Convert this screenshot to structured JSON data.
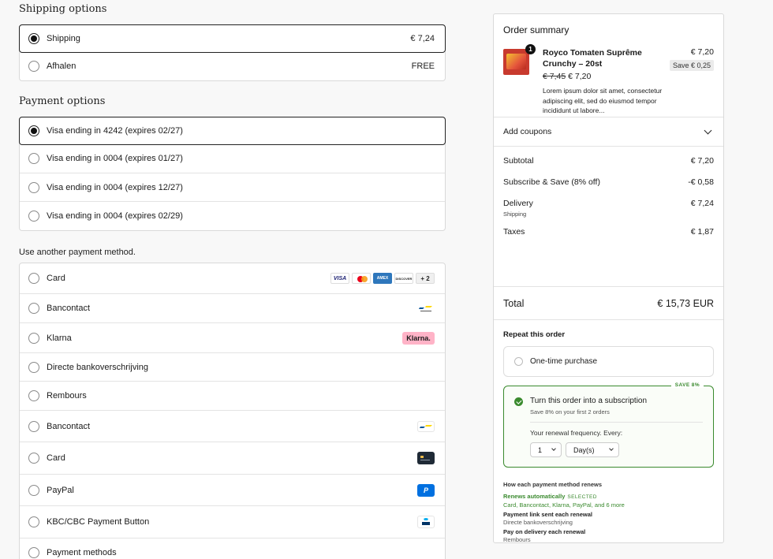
{
  "shipping": {
    "title": "Shipping options",
    "options": [
      {
        "label": "Shipping",
        "price": "€ 7,24",
        "selected": true
      },
      {
        "label": "Afhalen",
        "price": "FREE",
        "selected": false
      }
    ]
  },
  "payment": {
    "title": "Payment options",
    "cards": [
      {
        "label": "Visa ending in 4242 (expires 02/27)",
        "selected": true
      },
      {
        "label": "Visa ending in 0004 (expires 01/27)",
        "selected": false
      },
      {
        "label": "Visa ending in 0004 (expires 12/27)",
        "selected": false
      },
      {
        "label": "Visa ending in 0004 (expires 02/29)",
        "selected": false
      }
    ]
  },
  "other_methods": {
    "title": "Use another payment method.",
    "methods": [
      {
        "label": "Card",
        "icon": "card-brands-icon"
      },
      {
        "label": "Bancontact",
        "icon": "bancontact-icon"
      },
      {
        "label": "Klarna",
        "icon": "klarna-icon",
        "badge": "Klarna."
      },
      {
        "label": "Directe bankoverschrijving",
        "icon": ""
      },
      {
        "label": "Rembours",
        "icon": ""
      },
      {
        "label": "Bancontact",
        "icon": "bancontact-icon"
      },
      {
        "label": "Card",
        "icon": "credit-card-icon"
      },
      {
        "label": "PayPal",
        "icon": "paypal-icon"
      },
      {
        "label": "KBC/CBC Payment Button",
        "icon": "kbc-icon"
      },
      {
        "label": "Payment methods",
        "icon": ""
      }
    ],
    "card_brands": [
      "VISA",
      "",
      "AMEX",
      "DISCOVER",
      "+ 2"
    ]
  },
  "summary": {
    "title": "Order summary",
    "product": {
      "qty": "1",
      "name": "Royco Tomaten Suprême Crunchy – 20st",
      "price": "€ 7,20",
      "save": "Save € 0,25",
      "old_price": "€ 7,45",
      "new_price": "€ 7,20",
      "description": "Lorem ipsum dolor sit amet, consectetur adipiscing elit, sed do eiusmod tempor incididunt ut labore..."
    },
    "coupons_label": "Add coupons",
    "lines": [
      {
        "label": "Subtotal",
        "value": "€ 7,20",
        "sub": ""
      },
      {
        "label": "Subscribe & Save (8% off)",
        "value": "-€ 0,58",
        "sub": ""
      },
      {
        "label": "Delivery",
        "value": "€ 7,24",
        "sub": "Shipping"
      },
      {
        "label": "Taxes",
        "value": "€ 1,87",
        "sub": ""
      }
    ],
    "total_label": "Total",
    "total_value": "€ 15,73 EUR"
  },
  "repeat": {
    "title": "Repeat this order",
    "one_time": "One-time purchase",
    "save_tag": "SAVE 8%",
    "sub_title": "Turn this order into a subscription",
    "sub_sub": "Save 8% on your first 2 orders",
    "freq_label": "Your renewal frequency. Every:",
    "freq_value": "1",
    "freq_unit": "Day(s)"
  },
  "renewal": {
    "heading": "How each payment method renews",
    "auto_label": "Renews automatically",
    "auto_tag": "SELECTED",
    "auto_methods": "Card, Bancontact, Klarna, PayPal, and 6 more",
    "link_label": "Payment link sent each renewal",
    "link_methods": "Directe bankoverschrijving",
    "delivery_label": "Pay on delivery each renewal",
    "delivery_methods": "Rembours"
  },
  "colors": {
    "accent_green": "#3a8a2e",
    "klarna_pink": "#ffb3c7",
    "paypal_blue": "#0070e0",
    "bancontact_blue": "#005498",
    "bancontact_yellow": "#ffd800"
  }
}
